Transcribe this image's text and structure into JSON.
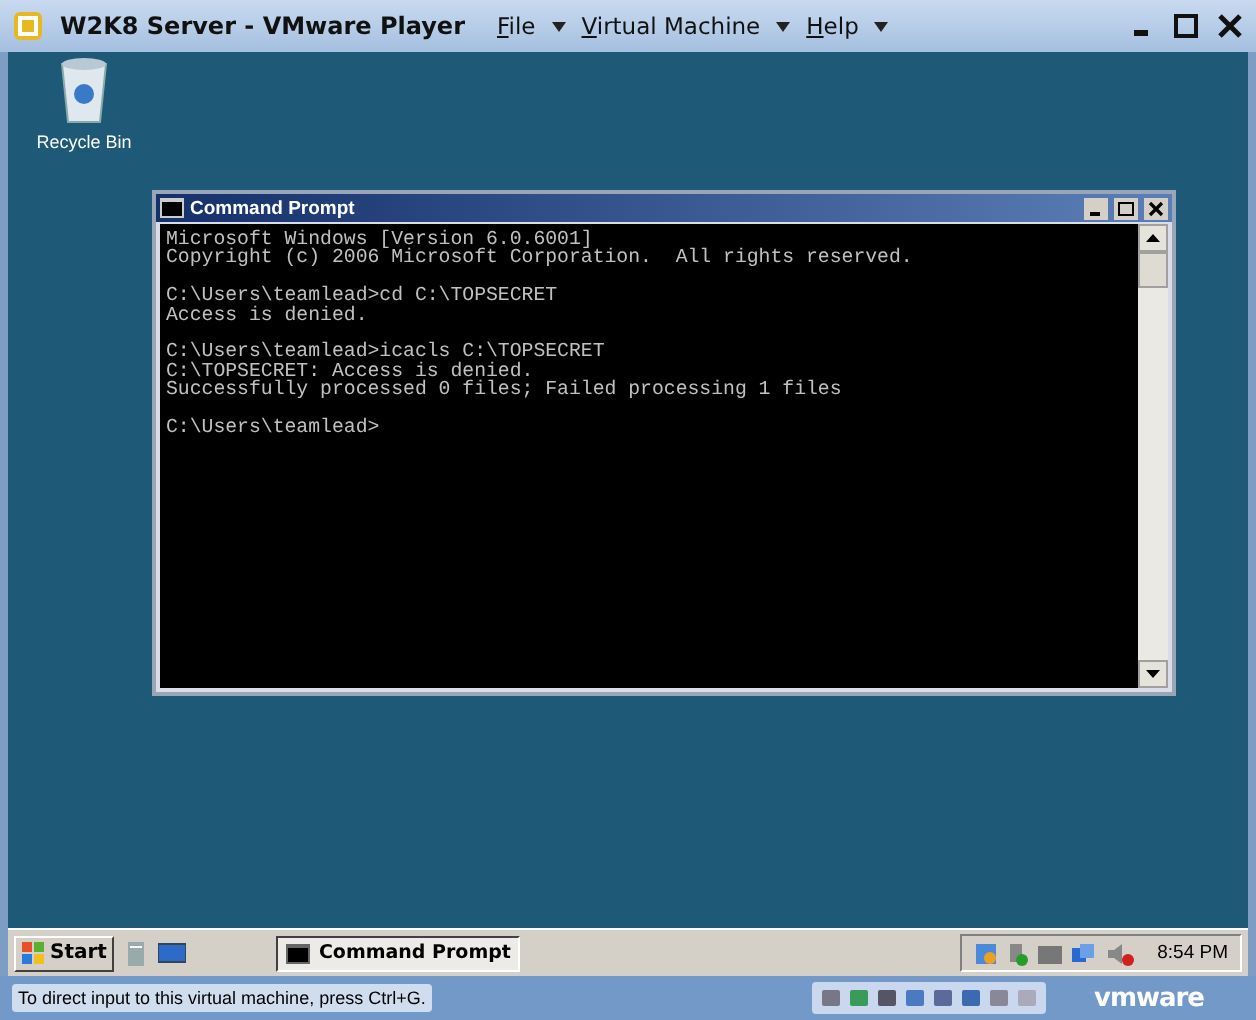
{
  "window": {
    "title": "W2K8 Server - VMware Player",
    "menu": [
      "File",
      "Virtual Machine",
      "Help"
    ]
  },
  "desktop": {
    "icons": [
      {
        "label": "Recycle Bin"
      }
    ]
  },
  "console": {
    "title": "Command Prompt",
    "blocks": [
      [
        "Microsoft Windows [Version 6.0.6001]",
        "Copyright (c) 2006 Microsoft Corporation.  All rights reserved."
      ],
      [
        "C:\\Users\\teamlead>cd C:\\TOPSECRET",
        "Access is denied."
      ],
      [
        "C:\\Users\\teamlead>icacls C:\\TOPSECRET",
        "C:\\TOPSECRET: Access is denied.",
        "Successfully processed 0 files; Failed processing 1 files"
      ],
      [
        "C:\\Users\\teamlead>"
      ]
    ]
  },
  "taskbar": {
    "start": "Start",
    "tasks": [
      {
        "label": "Command Prompt",
        "selected": true
      }
    ],
    "clock": "8:54 PM"
  },
  "status_bar": {
    "hint": "To direct input to this virtual machine, press Ctrl+G.",
    "logo": "vmware"
  }
}
